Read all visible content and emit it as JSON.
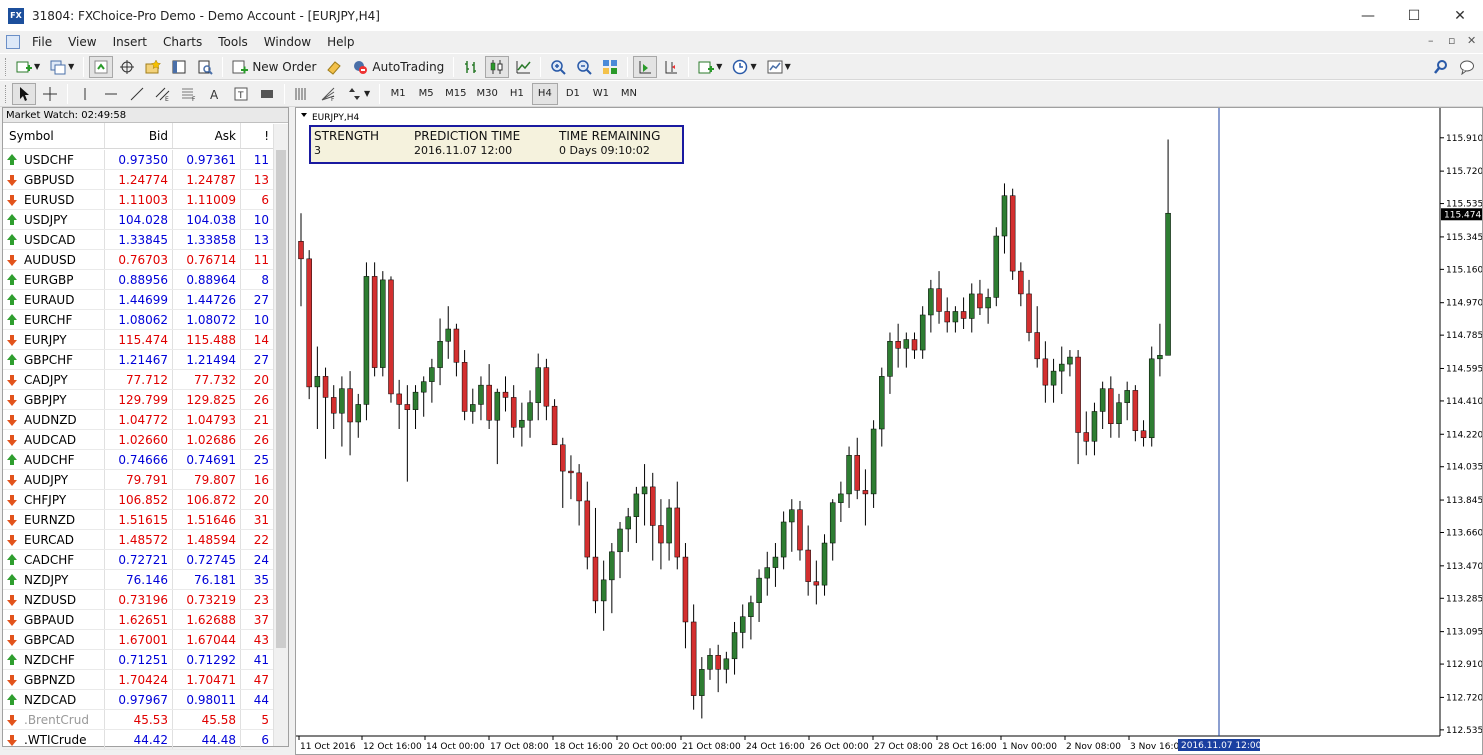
{
  "window": {
    "title": "31804: FXChoice-Pro Demo - Demo Account - [EURJPY,H4]",
    "icon_label": "FX",
    "minimize": "—",
    "maximize": "☐",
    "close": "✕"
  },
  "menu": [
    "File",
    "View",
    "Insert",
    "Charts",
    "Tools",
    "Window",
    "Help"
  ],
  "mdi_controls": [
    "–",
    "▫",
    "✕"
  ],
  "toolbar1": {
    "new_order": "New Order",
    "auto_trading": "AutoTrading"
  },
  "timeframes": [
    "M1",
    "M5",
    "M15",
    "M30",
    "H1",
    "H4",
    "D1",
    "W1",
    "MN"
  ],
  "active_timeframe": "H4",
  "market_watch": {
    "title": "Market Watch: 02:49:58",
    "headers": {
      "symbol": "Symbol",
      "bid": "Bid",
      "ask": "Ask",
      "spread": "!"
    },
    "rows": [
      {
        "symbol": "USDCHF",
        "bid": "0.97350",
        "ask": "0.97361",
        "spread": "11",
        "dir": "up",
        "color": "blue"
      },
      {
        "symbol": "GBPUSD",
        "bid": "1.24774",
        "ask": "1.24787",
        "spread": "13",
        "dir": "down",
        "color": "red"
      },
      {
        "symbol": "EURUSD",
        "bid": "1.11003",
        "ask": "1.11009",
        "spread": "6",
        "dir": "down",
        "color": "red"
      },
      {
        "symbol": "USDJPY",
        "bid": "104.028",
        "ask": "104.038",
        "spread": "10",
        "dir": "up",
        "color": "blue"
      },
      {
        "symbol": "USDCAD",
        "bid": "1.33845",
        "ask": "1.33858",
        "spread": "13",
        "dir": "up",
        "color": "blue"
      },
      {
        "symbol": "AUDUSD",
        "bid": "0.76703",
        "ask": "0.76714",
        "spread": "11",
        "dir": "down",
        "color": "red"
      },
      {
        "symbol": "EURGBP",
        "bid": "0.88956",
        "ask": "0.88964",
        "spread": "8",
        "dir": "up",
        "color": "blue"
      },
      {
        "symbol": "EURAUD",
        "bid": "1.44699",
        "ask": "1.44726",
        "spread": "27",
        "dir": "up",
        "color": "blue"
      },
      {
        "symbol": "EURCHF",
        "bid": "1.08062",
        "ask": "1.08072",
        "spread": "10",
        "dir": "up",
        "color": "blue"
      },
      {
        "symbol": "EURJPY",
        "bid": "115.474",
        "ask": "115.488",
        "spread": "14",
        "dir": "down",
        "color": "red"
      },
      {
        "symbol": "GBPCHF",
        "bid": "1.21467",
        "ask": "1.21494",
        "spread": "27",
        "dir": "up",
        "color": "blue"
      },
      {
        "symbol": "CADJPY",
        "bid": "77.712",
        "ask": "77.732",
        "spread": "20",
        "dir": "down",
        "color": "red"
      },
      {
        "symbol": "GBPJPY",
        "bid": "129.799",
        "ask": "129.825",
        "spread": "26",
        "dir": "down",
        "color": "red"
      },
      {
        "symbol": "AUDNZD",
        "bid": "1.04772",
        "ask": "1.04793",
        "spread": "21",
        "dir": "down",
        "color": "red"
      },
      {
        "symbol": "AUDCAD",
        "bid": "1.02660",
        "ask": "1.02686",
        "spread": "26",
        "dir": "down",
        "color": "red"
      },
      {
        "symbol": "AUDCHF",
        "bid": "0.74666",
        "ask": "0.74691",
        "spread": "25",
        "dir": "up",
        "color": "blue"
      },
      {
        "symbol": "AUDJPY",
        "bid": "79.791",
        "ask": "79.807",
        "spread": "16",
        "dir": "down",
        "color": "red"
      },
      {
        "symbol": "CHFJPY",
        "bid": "106.852",
        "ask": "106.872",
        "spread": "20",
        "dir": "down",
        "color": "red"
      },
      {
        "symbol": "EURNZD",
        "bid": "1.51615",
        "ask": "1.51646",
        "spread": "31",
        "dir": "down",
        "color": "red"
      },
      {
        "symbol": "EURCAD",
        "bid": "1.48572",
        "ask": "1.48594",
        "spread": "22",
        "dir": "down",
        "color": "red"
      },
      {
        "symbol": "CADCHF",
        "bid": "0.72721",
        "ask": "0.72745",
        "spread": "24",
        "dir": "up",
        "color": "blue"
      },
      {
        "symbol": "NZDJPY",
        "bid": "76.146",
        "ask": "76.181",
        "spread": "35",
        "dir": "up",
        "color": "blue"
      },
      {
        "symbol": "NZDUSD",
        "bid": "0.73196",
        "ask": "0.73219",
        "spread": "23",
        "dir": "down",
        "color": "red"
      },
      {
        "symbol": "GBPAUD",
        "bid": "1.62651",
        "ask": "1.62688",
        "spread": "37",
        "dir": "down",
        "color": "red"
      },
      {
        "symbol": "GBPCAD",
        "bid": "1.67001",
        "ask": "1.67044",
        "spread": "43",
        "dir": "down",
        "color": "red"
      },
      {
        "symbol": "NZDCHF",
        "bid": "0.71251",
        "ask": "0.71292",
        "spread": "41",
        "dir": "up",
        "color": "blue"
      },
      {
        "symbol": "GBPNZD",
        "bid": "1.70424",
        "ask": "1.70471",
        "spread": "47",
        "dir": "down",
        "color": "red"
      },
      {
        "symbol": "NZDCAD",
        "bid": "0.97967",
        "ask": "0.98011",
        "spread": "44",
        "dir": "up",
        "color": "blue"
      },
      {
        "symbol": ".BrentCrud",
        "bid": "45.53",
        "ask": "45.58",
        "spread": "5",
        "dir": "down",
        "color": "red",
        "symbol_grey": true
      },
      {
        "symbol": ".WTICrude",
        "bid": "44.42",
        "ask": "44.48",
        "spread": "6",
        "dir": "down",
        "color": "blue"
      }
    ]
  },
  "chart": {
    "label": "EURJPY,H4",
    "info_box": {
      "headers": [
        "STRENGTH",
        "PREDICTION TIME",
        "TIME REMAINING"
      ],
      "values": [
        "3",
        "2016.11.07 12:00",
        "0 Days 09:10:02"
      ]
    },
    "current_price": "115.474",
    "bull_color": "#2e7d32",
    "bear_color": "#d32f2f",
    "marker_color": "#1a3fa0"
  },
  "chart_data": {
    "type": "candlestick",
    "y_ticks": [
      "115.910",
      "115.720",
      "115.535",
      "115.345",
      "115.160",
      "114.970",
      "114.785",
      "114.595",
      "114.410",
      "114.220",
      "114.035",
      "113.845",
      "113.660",
      "113.470",
      "113.285",
      "113.095",
      "112.910",
      "112.720",
      "112.535"
    ],
    "ylim": [
      112.5,
      116.0
    ],
    "x_ticks": [
      "11 Oct 2016",
      "12 Oct 16:00",
      "14 Oct 00:00",
      "17 Oct 08:00",
      "18 Oct 16:00",
      "20 Oct 00:00",
      "21 Oct 08:00",
      "24 Oct 16:00",
      "26 Oct 00:00",
      "27 Oct 08:00",
      "28 Oct 16:00",
      "1 Nov 00:00",
      "2 Nov 08:00",
      "3 Nov 16:00"
    ],
    "x_marker_label": "2016.11.07 12:00",
    "candles": [
      [
        115.32,
        115.48,
        114.95,
        115.22
      ],
      [
        115.22,
        115.27,
        114.42,
        114.49
      ],
      [
        114.49,
        114.72,
        114.25,
        114.55
      ],
      [
        114.55,
        114.6,
        114.08,
        114.43
      ],
      [
        114.43,
        114.5,
        114.25,
        114.34
      ],
      [
        114.34,
        114.55,
        114.15,
        114.48
      ],
      [
        114.48,
        114.58,
        114.1,
        114.29
      ],
      [
        114.29,
        114.45,
        114.2,
        114.39
      ],
      [
        114.39,
        115.2,
        114.3,
        115.12
      ],
      [
        115.12,
        115.2,
        114.55,
        114.6
      ],
      [
        114.6,
        115.15,
        114.55,
        115.1
      ],
      [
        115.1,
        115.12,
        114.4,
        114.45
      ],
      [
        114.45,
        114.53,
        114.25,
        114.39
      ],
      [
        114.39,
        114.5,
        113.95,
        114.36
      ],
      [
        114.36,
        114.5,
        114.25,
        114.46
      ],
      [
        114.46,
        114.55,
        114.32,
        114.52
      ],
      [
        114.52,
        114.65,
        114.4,
        114.6
      ],
      [
        114.6,
        114.88,
        114.5,
        114.75
      ],
      [
        114.75,
        114.95,
        114.65,
        114.82
      ],
      [
        114.82,
        114.85,
        114.55,
        114.63
      ],
      [
        114.63,
        114.7,
        114.3,
        114.35
      ],
      [
        114.35,
        114.48,
        114.28,
        114.39
      ],
      [
        114.39,
        114.55,
        114.3,
        114.5
      ],
      [
        114.5,
        114.62,
        114.25,
        114.3
      ],
      [
        114.3,
        114.48,
        114.05,
        114.46
      ],
      [
        114.46,
        114.55,
        114.35,
        114.43
      ],
      [
        114.43,
        114.5,
        114.2,
        114.26
      ],
      [
        114.26,
        114.4,
        114.15,
        114.3
      ],
      [
        114.3,
        114.47,
        114.2,
        114.4
      ],
      [
        114.4,
        114.68,
        114.3,
        114.6
      ],
      [
        114.6,
        114.65,
        114.3,
        114.38
      ],
      [
        114.38,
        114.42,
        114.2,
        114.16
      ],
      [
        114.16,
        114.2,
        113.8,
        114.01
      ],
      [
        114.01,
        114.1,
        113.85,
        114.0
      ],
      [
        114.0,
        114.05,
        113.7,
        113.84
      ],
      [
        113.84,
        113.95,
        113.45,
        113.52
      ],
      [
        113.52,
        113.8,
        113.2,
        113.27
      ],
      [
        113.27,
        113.5,
        113.1,
        113.39
      ],
      [
        113.39,
        113.6,
        113.2,
        113.55
      ],
      [
        113.55,
        113.72,
        113.4,
        113.68
      ],
      [
        113.68,
        113.8,
        113.55,
        113.75
      ],
      [
        113.75,
        113.92,
        113.6,
        113.88
      ],
      [
        113.88,
        114.05,
        113.7,
        113.92
      ],
      [
        113.92,
        114.0,
        113.5,
        113.7
      ],
      [
        113.7,
        113.85,
        113.45,
        113.6
      ],
      [
        113.6,
        113.85,
        113.5,
        113.8
      ],
      [
        113.8,
        113.95,
        113.45,
        113.52
      ],
      [
        113.52,
        113.6,
        113.0,
        113.15
      ],
      [
        113.15,
        113.25,
        112.65,
        112.73
      ],
      [
        112.73,
        112.95,
        112.6,
        112.88
      ],
      [
        112.88,
        113.0,
        112.82,
        112.96
      ],
      [
        112.96,
        113.02,
        112.75,
        112.88
      ],
      [
        112.88,
        112.98,
        112.8,
        112.94
      ],
      [
        112.94,
        113.15,
        112.85,
        113.09
      ],
      [
        113.09,
        113.25,
        113.0,
        113.18
      ],
      [
        113.18,
        113.3,
        113.05,
        113.26
      ],
      [
        113.26,
        113.45,
        113.15,
        113.4
      ],
      [
        113.4,
        113.55,
        113.3,
        113.46
      ],
      [
        113.46,
        113.6,
        113.35,
        113.52
      ],
      [
        113.52,
        113.78,
        113.45,
        113.72
      ],
      [
        113.72,
        113.85,
        113.55,
        113.79
      ],
      [
        113.79,
        113.84,
        113.5,
        113.56
      ],
      [
        113.56,
        113.7,
        113.3,
        113.38
      ],
      [
        113.38,
        113.5,
        113.25,
        113.36
      ],
      [
        113.36,
        113.65,
        113.3,
        113.6
      ],
      [
        113.6,
        113.85,
        113.5,
        113.83
      ],
      [
        113.83,
        113.95,
        113.72,
        113.88
      ],
      [
        113.88,
        114.15,
        113.8,
        114.1
      ],
      [
        114.1,
        114.2,
        113.85,
        113.9
      ],
      [
        113.9,
        114.02,
        113.7,
        113.88
      ],
      [
        113.88,
        114.3,
        113.8,
        114.25
      ],
      [
        114.25,
        114.6,
        114.15,
        114.55
      ],
      [
        114.55,
        114.8,
        114.45,
        114.75
      ],
      [
        114.75,
        114.85,
        114.6,
        114.71
      ],
      [
        114.71,
        114.8,
        114.6,
        114.76
      ],
      [
        114.76,
        114.8,
        114.65,
        114.7
      ],
      [
        114.7,
        114.95,
        114.65,
        114.9
      ],
      [
        114.9,
        115.1,
        114.8,
        115.05
      ],
      [
        115.05,
        115.15,
        114.85,
        114.92
      ],
      [
        114.92,
        115.0,
        114.8,
        114.86
      ],
      [
        114.86,
        114.95,
        114.8,
        114.92
      ],
      [
        114.92,
        115.0,
        114.82,
        114.88
      ],
      [
        114.88,
        115.08,
        114.8,
        115.02
      ],
      [
        115.02,
        115.1,
        114.9,
        114.94
      ],
      [
        114.94,
        115.05,
        114.85,
        115.0
      ],
      [
        115.0,
        115.4,
        114.95,
        115.35
      ],
      [
        115.35,
        115.65,
        115.25,
        115.58
      ],
      [
        115.58,
        115.62,
        115.1,
        115.15
      ],
      [
        115.15,
        115.2,
        114.95,
        115.02
      ],
      [
        115.02,
        115.1,
        114.75,
        114.8
      ],
      [
        114.8,
        114.95,
        114.6,
        114.65
      ],
      [
        114.65,
        114.75,
        114.4,
        114.5
      ],
      [
        114.5,
        114.65,
        114.4,
        114.58
      ],
      [
        114.58,
        114.72,
        114.45,
        114.62
      ],
      [
        114.62,
        114.7,
        114.55,
        114.66
      ],
      [
        114.66,
        114.7,
        114.05,
        114.23
      ],
      [
        114.23,
        114.35,
        114.1,
        114.18
      ],
      [
        114.18,
        114.4,
        114.1,
        114.35
      ],
      [
        114.35,
        114.52,
        114.25,
        114.48
      ],
      [
        114.48,
        114.55,
        114.2,
        114.28
      ],
      [
        114.28,
        114.45,
        114.2,
        114.4
      ],
      [
        114.4,
        114.52,
        114.3,
        114.47
      ],
      [
        114.47,
        114.5,
        114.18,
        114.24
      ],
      [
        114.24,
        114.3,
        114.15,
        114.2
      ],
      [
        114.2,
        114.72,
        114.15,
        114.65
      ],
      [
        114.65,
        114.85,
        114.55,
        114.67
      ],
      [
        114.67,
        115.9,
        114.8,
        115.48
      ]
    ]
  }
}
